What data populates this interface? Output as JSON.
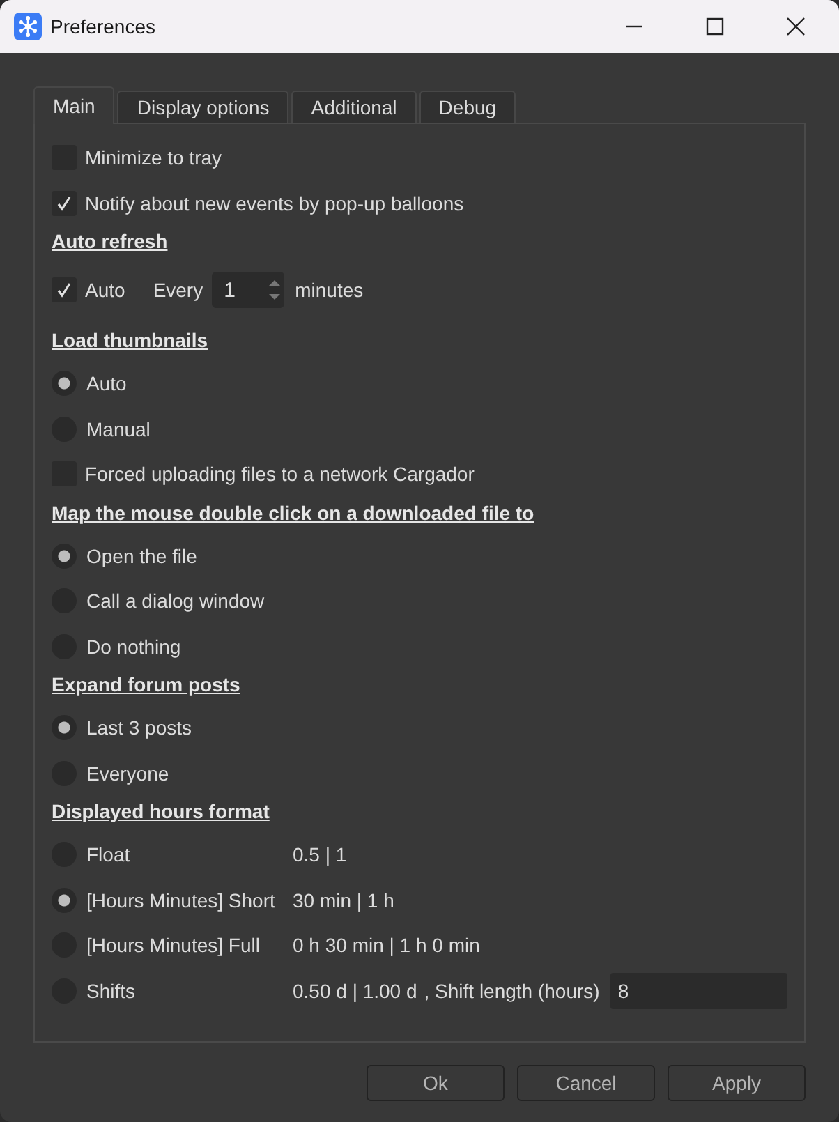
{
  "window": {
    "title": "Preferences"
  },
  "tabs": [
    {
      "label": "Main",
      "selected": true
    },
    {
      "label": "Display options",
      "selected": false
    },
    {
      "label": "Additional",
      "selected": false
    },
    {
      "label": "Debug",
      "selected": false
    }
  ],
  "rows": [
    {
      "kind": "checkbox",
      "label": "Minimize to tray",
      "checked": false
    },
    {
      "kind": "checkbox",
      "label": "Notify about new events by pop-up balloons",
      "checked": true
    },
    {
      "kind": "heading",
      "text": "Auto refresh"
    },
    {
      "kind": "refresh",
      "label": "Auto",
      "checked": true,
      "every": "Every",
      "value": "1",
      "unit": "minutes"
    },
    {
      "kind": "heading",
      "text": "Load thumbnails"
    },
    {
      "kind": "radio",
      "label": "Auto",
      "selected": true
    },
    {
      "kind": "radio",
      "label": "Manual",
      "selected": false
    },
    {
      "kind": "checkbox",
      "label": "Forced uploading files to a network Cargador",
      "checked": false
    },
    {
      "kind": "heading",
      "text": "Map the mouse double click on a downloaded file to"
    },
    {
      "kind": "radio",
      "label": "Open the file",
      "selected": true
    },
    {
      "kind": "radio",
      "label": "Call a dialog window",
      "selected": false
    },
    {
      "kind": "radio",
      "label": "Do nothing",
      "selected": false
    },
    {
      "kind": "heading",
      "text": "Expand forum posts"
    },
    {
      "kind": "radio",
      "label": "Last 3 posts",
      "selected": true
    },
    {
      "kind": "radio",
      "label": "Everyone",
      "selected": false
    },
    {
      "kind": "heading",
      "text": "Displayed hours format"
    },
    {
      "kind": "radio",
      "label": "Float",
      "selected": false,
      "sample": "0.5 | 1"
    },
    {
      "kind": "radio",
      "label": "[Hours Minutes] Short",
      "selected": true,
      "sample": "30 min | 1 h"
    },
    {
      "kind": "radio",
      "label": "[Hours Minutes] Full",
      "selected": false,
      "sample": "0 h 30 min | 1 h 0 min"
    },
    {
      "kind": "radio",
      "label": "Shifts",
      "selected": false,
      "sample": "0.50 d | 1.00 d",
      "extra_label": ", Shift length (hours)",
      "extra_value": "8"
    }
  ],
  "buttons": [
    "Ok",
    "Cancel",
    "Apply"
  ]
}
